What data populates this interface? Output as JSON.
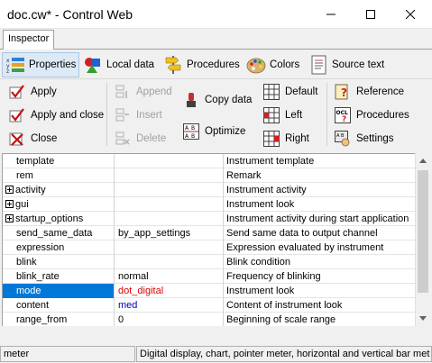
{
  "window": {
    "title": "doc.cw* - Control Web"
  },
  "tabs": {
    "active_label": "Inspector"
  },
  "menu": {
    "properties": "Properties",
    "local_data": "Local data",
    "procedures": "Procedures",
    "colors": "Colors",
    "source_text": "Source text"
  },
  "toolbar": {
    "apply": "Apply",
    "apply_and_close": "Apply and close",
    "close": "Close",
    "append": "Append",
    "insert": "Insert",
    "delete": "Delete",
    "copy_data": "Copy data",
    "optimize": "Optimize",
    "default": "Default",
    "left": "Left",
    "right": "Right",
    "reference": "Reference",
    "procedures": "Procedures",
    "settings": "Settings"
  },
  "grid": {
    "rows": [
      {
        "name": "template",
        "value": "",
        "description": "Instrument template"
      },
      {
        "name": "rem",
        "value": "",
        "description": "Remark"
      },
      {
        "name": "activity",
        "value": "",
        "description": "Instrument activity"
      },
      {
        "name": "gui",
        "value": "",
        "description": "Instrument look"
      },
      {
        "name": "startup_options",
        "value": "",
        "description": "Instrument activity during start application"
      },
      {
        "name": "send_same_data",
        "value": "by_app_settings",
        "description": "Send same data to output channel"
      },
      {
        "name": "expression",
        "value": "",
        "description": "Expression evaluated by instrument"
      },
      {
        "name": "blink",
        "value": "",
        "description": "Blink condition"
      },
      {
        "name": "blink_rate",
        "value": "normal",
        "description": "Frequency of blinking"
      },
      {
        "name": "mode",
        "value": "dot_digital",
        "description": "Instrument look"
      },
      {
        "name": "content",
        "value": "med",
        "description": "Content of instrument look"
      },
      {
        "name": "range_from",
        "value": "0",
        "description": "Beginning of scale range"
      }
    ]
  },
  "status": {
    "instrument": "meter",
    "description": "Digital display, chart, pointer meter, horizontal and vertical bar met"
  },
  "colors": {
    "selection": "#0078d7",
    "highlight_red": "#e00000",
    "highlight_blue": "#0000c0"
  }
}
